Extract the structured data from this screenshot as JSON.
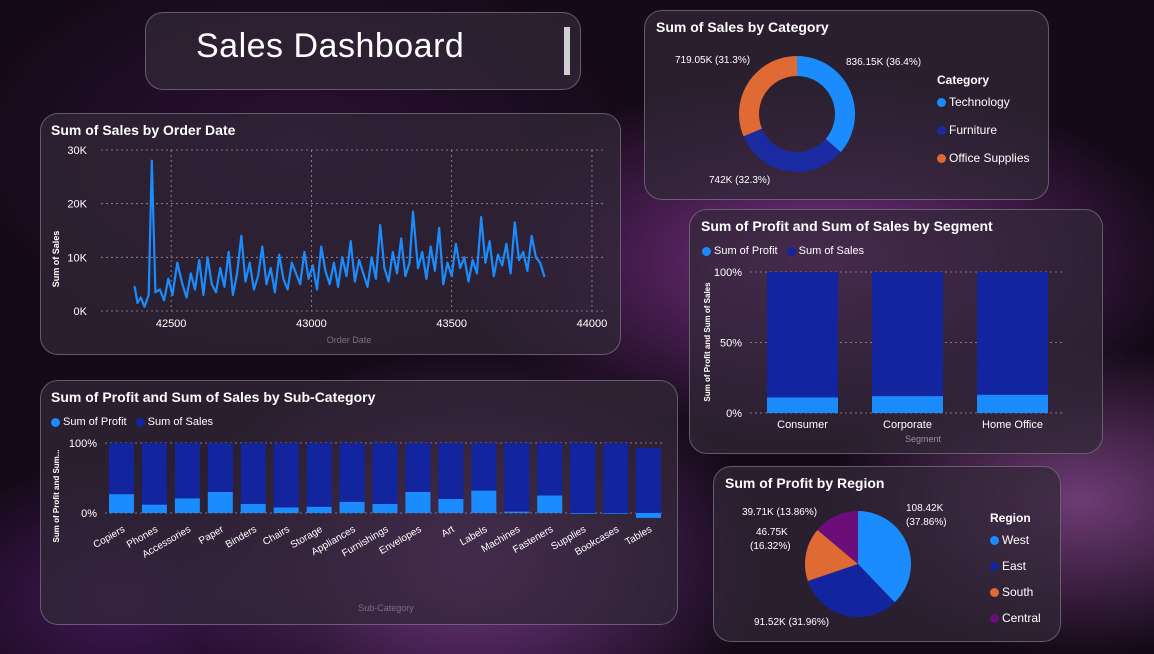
{
  "header": {
    "title": "Sales Dashboard"
  },
  "colors": {
    "technology": "#1a8cff",
    "furniture": "#1a2aa0",
    "office_supplies": "#e06a34",
    "central": "#6b0e7a",
    "profit": "#1a8cff",
    "sales": "#12259e"
  },
  "order_date_chart": {
    "title": "Sum of Sales by Order Date",
    "ylabel": "Sum of Sales",
    "xlabel": "Order Date",
    "yticks": [
      "30K",
      "20K",
      "10K",
      "0K"
    ],
    "xticks": [
      "42500",
      "43000",
      "43500",
      "44000"
    ]
  },
  "category_chart": {
    "title": "Sum of Sales by Category",
    "legend_title": "Category",
    "labels": {
      "technology": "836.15K (36.4%)",
      "furniture": "742K (32.3%)",
      "office_supplies": "719.05K (31.3%)"
    },
    "legend": [
      "Technology",
      "Furniture",
      "Office Supplies"
    ]
  },
  "segment_chart": {
    "title": "Sum of Profit and Sum of Sales by Segment",
    "legend": [
      "Sum of Profit",
      "Sum of Sales"
    ],
    "ylabel": "Sum of Profit and Sum of Sales",
    "xlabel": "Segment",
    "yticks": [
      "100%",
      "50%",
      "0%"
    ]
  },
  "subcat_chart": {
    "title": "Sum of Profit and Sum of Sales by Sub-Category",
    "legend": [
      "Sum of Profit",
      "Sum of Sales"
    ],
    "ylabel": "Sum of Profit and Sum...",
    "xlabel": "Sub-Category",
    "yticks": [
      "100%",
      "0%"
    ]
  },
  "region_chart": {
    "title": "Sum of Profit by Region",
    "legend_title": "Region",
    "legend": [
      "West",
      "East",
      "South",
      "Central"
    ],
    "labels": {
      "west_1": "108.42K",
      "west_2": "(37.86%)",
      "east": "91.52K (31.96%)",
      "south_1": "46.75K",
      "south_2": "(16.32%)",
      "central": "39.71K (13.86%)"
    }
  },
  "chart_data": [
    {
      "type": "line",
      "title": "Sum of Sales by Order Date",
      "xlabel": "Order Date",
      "ylabel": "Sum of Sales",
      "xlim": [
        42250,
        44050
      ],
      "ylim": [
        0,
        30000
      ],
      "series": [
        {
          "x": [
            42370,
            42380,
            42392,
            42405,
            42420,
            42431,
            42444,
            42460,
            42475,
            42490,
            42505,
            42522,
            42540,
            42555,
            42570,
            42585,
            42600,
            42615,
            42630,
            42645,
            42660,
            42675,
            42690,
            42705,
            42720,
            42735,
            42750,
            42765,
            42780,
            42795,
            42810,
            42825,
            42840,
            42855,
            42870,
            42885,
            42900,
            42915,
            42930,
            42945,
            42960,
            42975,
            42990,
            43005,
            43020,
            43035,
            43050,
            43065,
            43080,
            43095,
            43110,
            43125,
            43140,
            43155,
            43170,
            43185,
            43200,
            43215,
            43230,
            43245,
            43260,
            43275,
            43290,
            43305,
            43320,
            43335,
            43350,
            43362,
            43380,
            43395,
            43410,
            43425,
            43440,
            43455,
            43470,
            43485,
            43500,
            43515,
            43530,
            43545,
            43560,
            43575,
            43590,
            43605,
            43620,
            43635,
            43650,
            43665,
            43680,
            43695,
            43710,
            43725,
            43740,
            43755,
            43770,
            43785,
            43800,
            43815,
            43830
          ],
          "y": [
            4500,
            1500,
            2500,
            800,
            3000,
            28000,
            3500,
            4000,
            2000,
            6000,
            3000,
            9000,
            5000,
            2500,
            7000,
            4000,
            9500,
            3000,
            10000,
            5000,
            3500,
            8000,
            4500,
            11000,
            3000,
            7000,
            14000,
            5500,
            9000,
            4000,
            6500,
            12000,
            5000,
            8000,
            3500,
            10500,
            6000,
            4000,
            9000,
            7000,
            5000,
            11000,
            6000,
            8500,
            4000,
            12000,
            7500,
            5000,
            9000,
            4500,
            10000,
            6500,
            13000,
            5500,
            9500,
            7000,
            4500,
            10000,
            6000,
            16000,
            8000,
            5500,
            11000,
            7000,
            13500,
            6500,
            9000,
            18500,
            8000,
            11000,
            6000,
            12000,
            7500,
            15500,
            5000,
            9000,
            6500,
            12500,
            8000,
            10000,
            5500,
            9500,
            7000,
            17500,
            9000,
            13000,
            6500,
            10500,
            8500,
            12500,
            7000,
            16500,
            9500,
            11000,
            7500,
            14000,
            10000,
            9000,
            6500
          ]
        }
      ]
    },
    {
      "type": "pie",
      "title": "Sum of Sales by Category",
      "categories": [
        "Technology",
        "Furniture",
        "Office Supplies"
      ],
      "values": [
        836.15,
        742.0,
        719.05
      ],
      "percent": [
        36.4,
        32.3,
        31.3
      ]
    },
    {
      "type": "bar",
      "title": "Sum of Profit and Sum of Sales by Segment",
      "categories": [
        "Consumer",
        "Corporate",
        "Home Office"
      ],
      "ylim": [
        0,
        100
      ],
      "series": [
        {
          "name": "Sum of Profit",
          "values": [
            11,
            12,
            13
          ]
        },
        {
          "name": "Sum of Sales",
          "values": [
            89,
            88,
            87
          ]
        }
      ]
    },
    {
      "type": "bar",
      "title": "Sum of Profit and Sum of Sales by Sub-Category",
      "categories": [
        "Copiers",
        "Phones",
        "Accessories",
        "Paper",
        "Binders",
        "Chairs",
        "Storage",
        "Appliances",
        "Furnishings",
        "Envelopes",
        "Art",
        "Labels",
        "Machines",
        "Fasteners",
        "Supplies",
        "Bookcases",
        "Tables"
      ],
      "ylim": [
        0,
        100
      ],
      "series": [
        {
          "name": "Sum of Profit",
          "values": [
            27,
            12,
            21,
            30,
            13,
            8,
            9,
            16,
            13,
            30,
            20,
            32,
            2,
            25,
            -1,
            -1,
            -7
          ]
        },
        {
          "name": "Sum of Sales",
          "values": [
            73,
            88,
            79,
            70,
            87,
            92,
            91,
            84,
            87,
            70,
            80,
            68,
            98,
            75,
            101,
            101,
            100
          ]
        }
      ]
    },
    {
      "type": "pie",
      "title": "Sum of Profit by Region",
      "categories": [
        "West",
        "East",
        "South",
        "Central"
      ],
      "values": [
        108.42,
        91.52,
        46.75,
        39.71
      ],
      "percent": [
        37.86,
        31.96,
        16.32,
        13.86
      ]
    }
  ]
}
